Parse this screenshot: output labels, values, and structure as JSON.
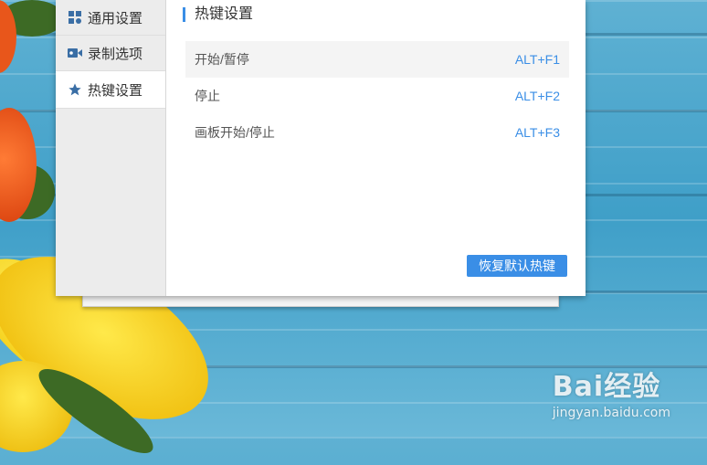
{
  "sidebar": {
    "items": [
      {
        "label": "通用设置",
        "icon": "grid-icon"
      },
      {
        "label": "录制选项",
        "icon": "video-camera-icon"
      },
      {
        "label": "热键设置",
        "icon": "star-icon"
      }
    ],
    "active_index": 2
  },
  "main": {
    "section_title": "热键设置",
    "hotkeys": [
      {
        "action": "开始/暂停",
        "key": "ALT+F1"
      },
      {
        "action": "停止",
        "key": "ALT+F2"
      },
      {
        "action": "画板开始/停止",
        "key": "ALT+F3"
      }
    ],
    "restore_button": "恢复默认热键"
  },
  "watermark": {
    "brand": "Bai经验",
    "url": "jingyan.baidu.com"
  },
  "colors": {
    "accent": "#3a8ee6",
    "sidebar_bg": "#ececec",
    "row_alt_bg": "#f4f4f4"
  }
}
